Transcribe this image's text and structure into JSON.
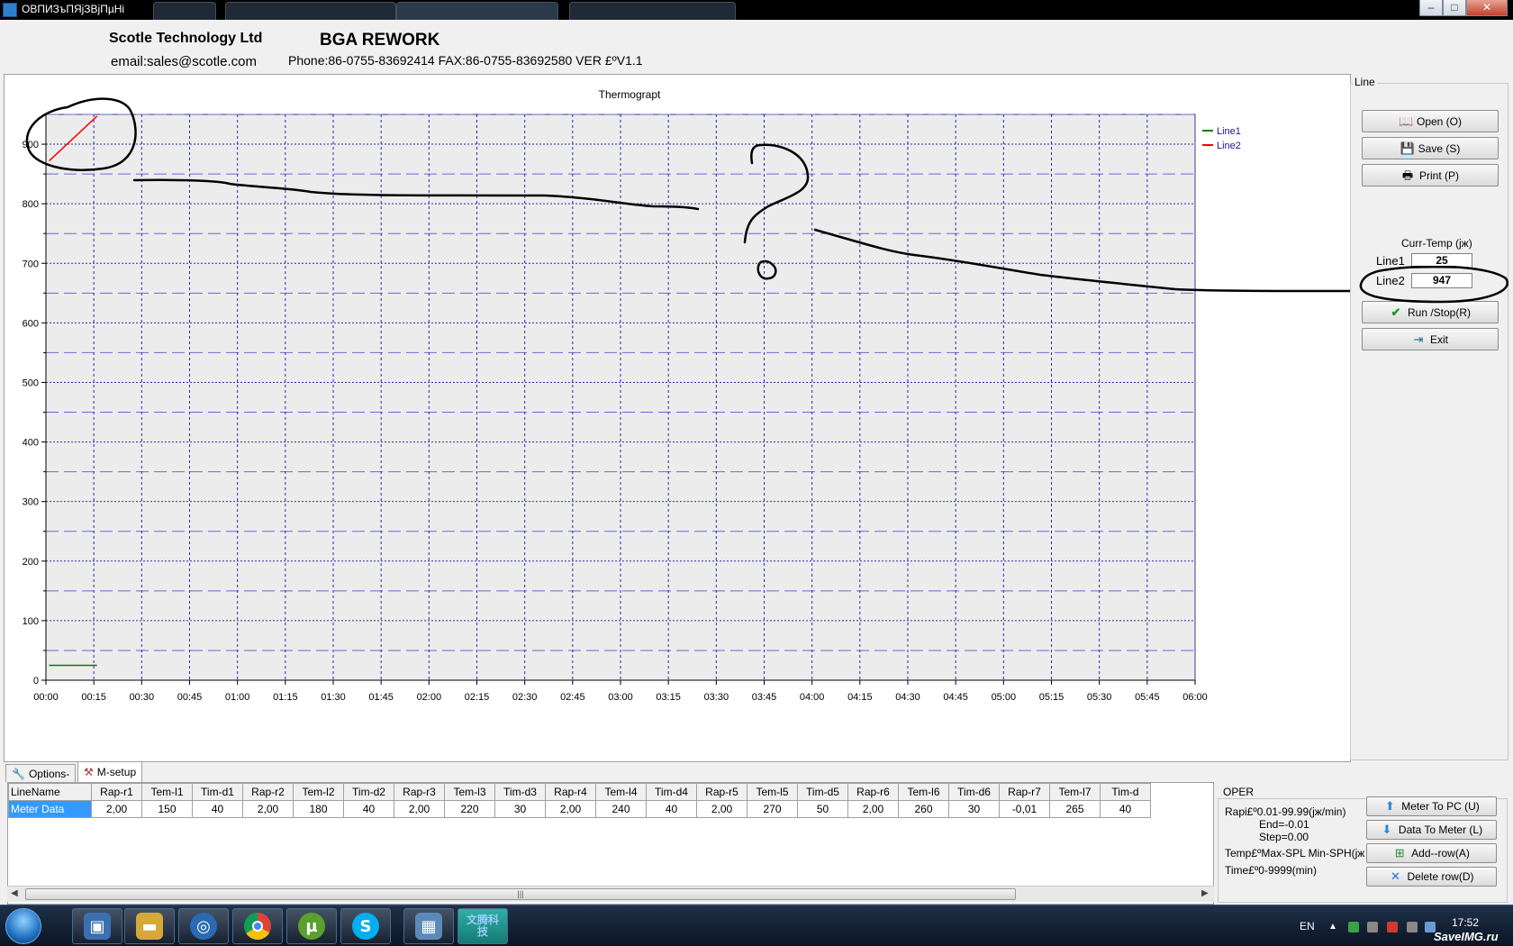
{
  "window": {
    "title": "ОВПИЗъПЯјЗВјПµНі"
  },
  "header": {
    "company": "Scotle Technology Ltd",
    "email": "email:sales@scotle.com",
    "product": "BGA REWORK",
    "contact": "Phone:86-0755-83692414  FAX:86-0755-83692580   VER £ºV1.1"
  },
  "chart_data": {
    "type": "line",
    "title": "Thermograpt",
    "x_ticks": [
      "00:00",
      "00:15",
      "00:30",
      "00:45",
      "01:00",
      "01:15",
      "01:30",
      "01:45",
      "02:00",
      "02:15",
      "02:30",
      "02:45",
      "03:00",
      "03:15",
      "03:30",
      "03:45",
      "04:00",
      "04:15",
      "04:30",
      "04:45",
      "05:00",
      "05:15",
      "05:30",
      "05:45",
      "06:00"
    ],
    "xlim_minutes": [
      0,
      360
    ],
    "ylim": [
      0,
      950
    ],
    "y_ticks": [
      0,
      100,
      200,
      300,
      400,
      500,
      600,
      700,
      800,
      900
    ],
    "grid": true,
    "legend_position": "top-right",
    "series": [
      {
        "name": "Line1",
        "color": "#008000",
        "x_minutes": [
          1,
          16
        ],
        "y": [
          25,
          25
        ]
      },
      {
        "name": "Line2",
        "color": "#ff0000",
        "x_minutes": [
          1,
          16
        ],
        "y": [
          872,
          947
        ]
      }
    ]
  },
  "side": {
    "group_title": "Line",
    "open_label": "Open (O)",
    "save_label": "Save (S)",
    "print_label": "Print (P)",
    "curr_temp_label": "Curr-Temp (јж)",
    "line1_label": "Line1",
    "line1_value": "25",
    "line2_label": "Line2",
    "line2_value": "947",
    "run_label": "Run /Stop(R)",
    "exit_label": "Exit"
  },
  "tabs": {
    "options": "Options-",
    "msetup": "M-setup"
  },
  "table": {
    "headers": [
      "LineName",
      "Rap-r1",
      "Tem-l1",
      "Tim-d1",
      "Rap-r2",
      "Tem-l2",
      "Tim-d2",
      "Rap-r3",
      "Tem-l3",
      "Tim-d3",
      "Rap-r4",
      "Tem-l4",
      "Tim-d4",
      "Rap-r5",
      "Tem-l5",
      "Tim-d5",
      "Rap-r6",
      "Tem-l6",
      "Tim-d6",
      "Rap-r7",
      "Tem-l7",
      "Tim-d"
    ],
    "row": [
      "Meter Data",
      "2,00",
      "150",
      "40",
      "2,00",
      "180",
      "40",
      "2,00",
      "220",
      "30",
      "2,00",
      "240",
      "40",
      "2,00",
      "270",
      "50",
      "2,00",
      "260",
      "30",
      "-0,01",
      "265",
      "40"
    ]
  },
  "oper": {
    "title": "OPER",
    "rap_text": "Rapi£º0.01-99.99(јж/min)",
    "end_text": "End=-0.01",
    "step_text": "Step=0.00",
    "temp_text": "Temp£ºMax-SPL Min-SPH(јж",
    "time_text": "Time£º0-9999(min)",
    "meter_to_pc": "Meter To PC  (U)",
    "data_to_meter": "Data To Meter (L)",
    "add_row": "Add--row(A)",
    "delete_row": "Delete row(D)"
  },
  "taskbar": {
    "lang": "EN",
    "clock": "17:52",
    "watermark": "SaveIMG.ru",
    "active_app_text": "文腾科技"
  }
}
